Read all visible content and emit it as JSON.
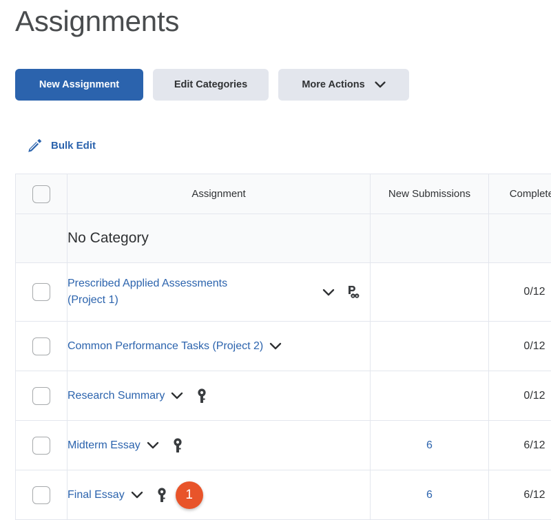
{
  "page": {
    "title": "Assignments"
  },
  "toolbar": {
    "new_assignment_label": "New Assignment",
    "edit_categories_label": "Edit Categories",
    "more_actions_label": "More Actions",
    "bulk_edit_label": "Bulk Edit",
    "primary_color": "#2b63ad",
    "secondary_color": "#e3e6ed"
  },
  "table": {
    "columns": [
      {
        "key": "select",
        "label": ""
      },
      {
        "key": "assignment",
        "label": "Assignment"
      },
      {
        "key": "new_submissions",
        "label": "New Submissions"
      },
      {
        "key": "completed",
        "label": "Completed"
      }
    ],
    "category": "No Category",
    "rows": [
      {
        "name": "Prescribed Applied Assessments (Project 1)",
        "icons": [
          "chevron-down-icon",
          "linked-rubric-icon"
        ],
        "new_submissions": "",
        "completed": "0/12",
        "badge": null
      },
      {
        "name": "Common Performance Tasks (Project 2)",
        "icons": [
          "chevron-down-icon"
        ],
        "new_submissions": "",
        "completed": "0/12",
        "badge": null
      },
      {
        "name": "Research Summary",
        "icons": [
          "chevron-down-icon",
          "key-icon"
        ],
        "new_submissions": "",
        "completed": "0/12",
        "badge": null
      },
      {
        "name": "Midterm Essay",
        "icons": [
          "chevron-down-icon",
          "key-icon"
        ],
        "new_submissions": "6",
        "completed": "6/12",
        "badge": null
      },
      {
        "name": "Final Essay",
        "icons": [
          "chevron-down-icon",
          "key-icon"
        ],
        "new_submissions": "6",
        "completed": "6/12",
        "badge": "1"
      }
    ],
    "badge_color": "#e8542a"
  }
}
